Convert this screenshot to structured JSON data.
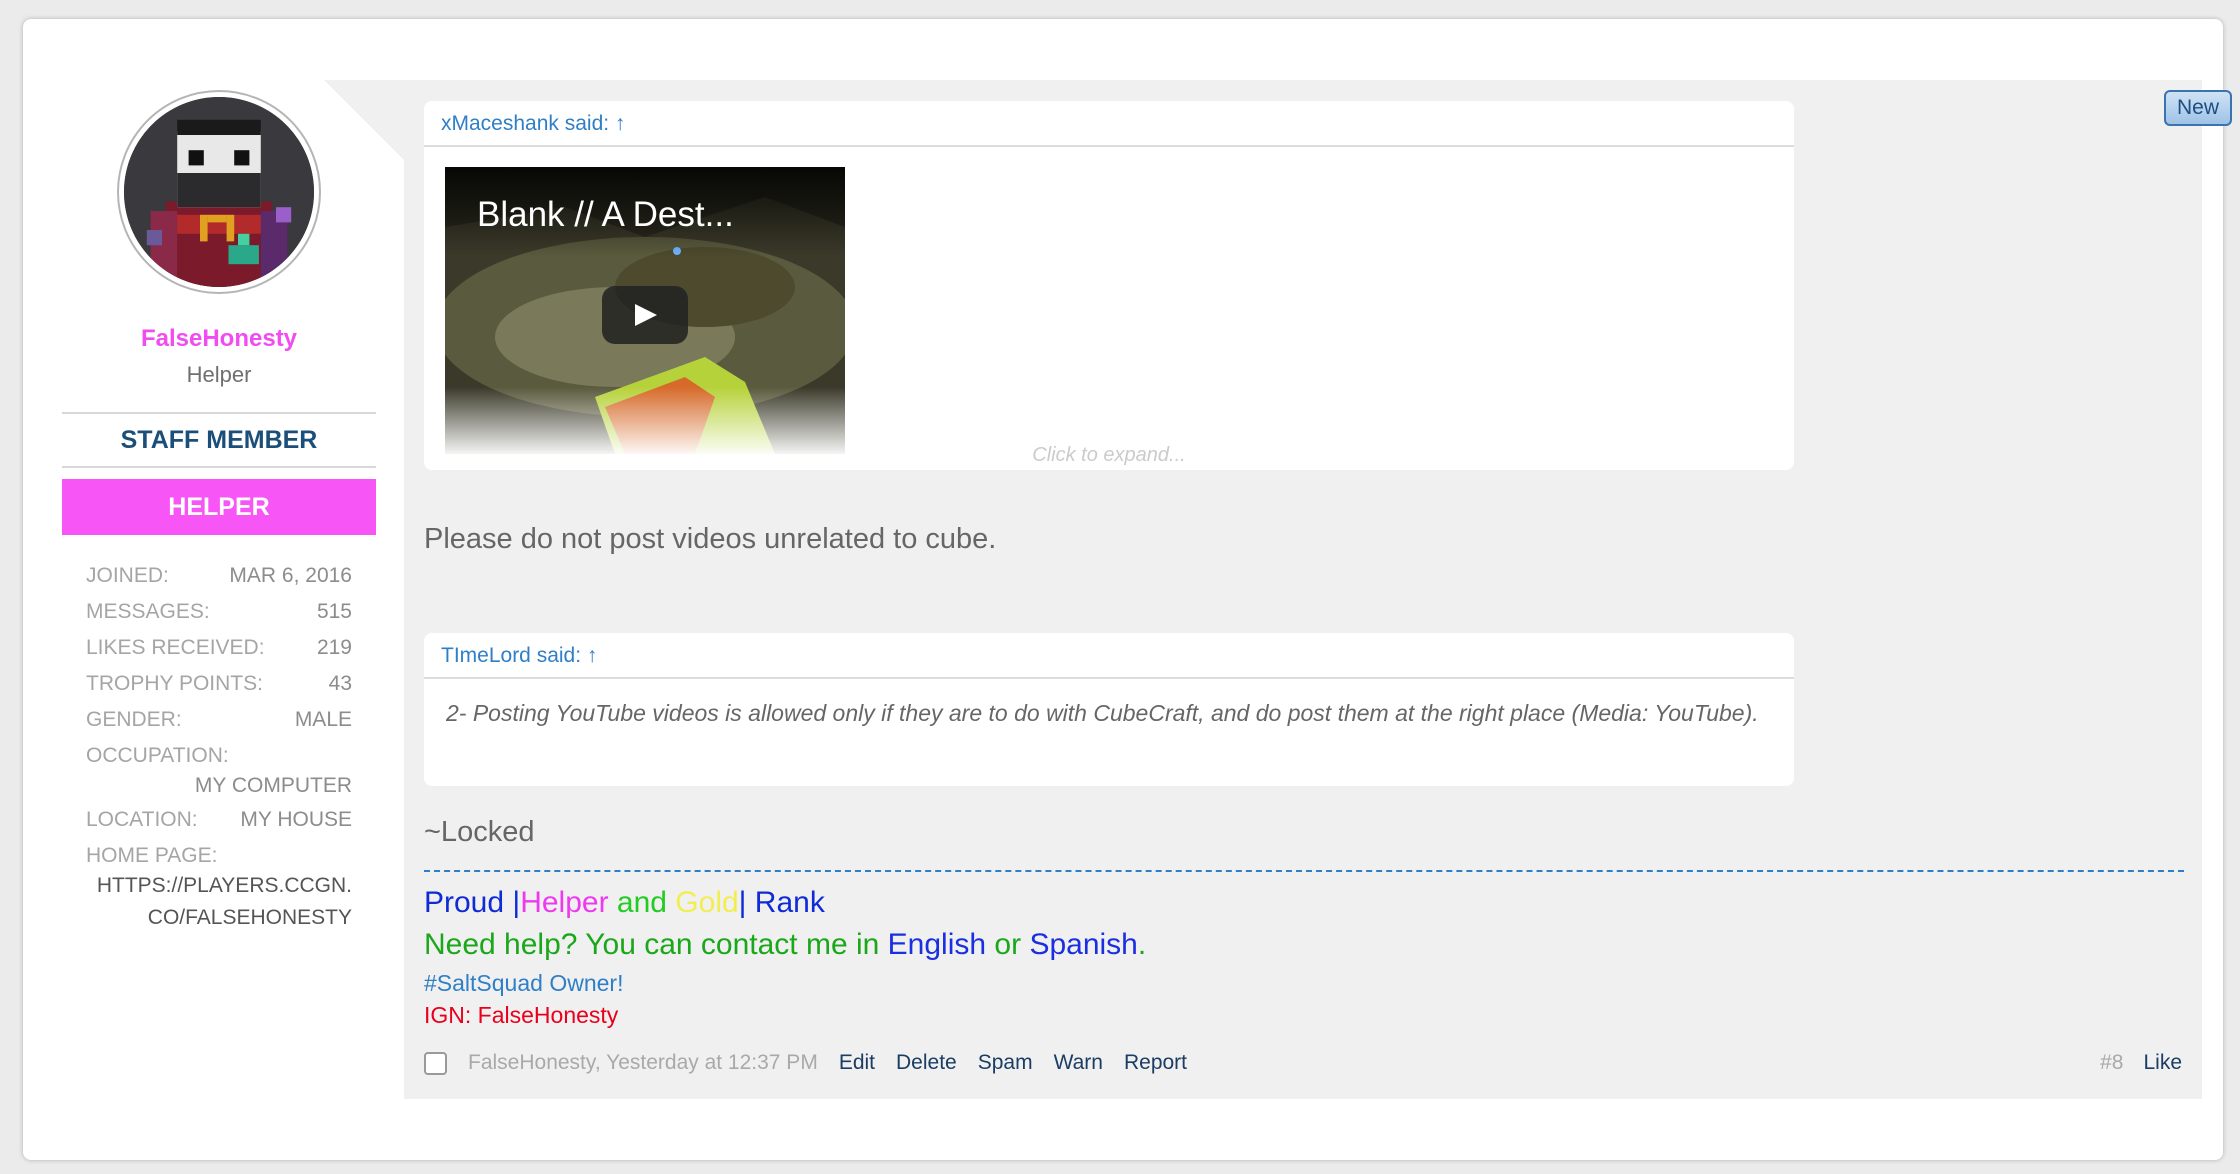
{
  "user": {
    "name": "FalseHonesty",
    "title": "Helper",
    "staff_banner": "STAFF MEMBER",
    "rank_banner": "HELPER",
    "stats": [
      {
        "label": "JOINED:",
        "value": "MAR 6, 2016"
      },
      {
        "label": "MESSAGES:",
        "value": "515"
      },
      {
        "label": "LIKES RECEIVED:",
        "value": "219"
      },
      {
        "label": "TROPHY POINTS:",
        "value": "43"
      },
      {
        "label": "GENDER:",
        "value": "MALE"
      }
    ],
    "occupation": {
      "label": "OCCUPATION:",
      "value": "MY COMPUTER"
    },
    "location": {
      "label": "LOCATION:",
      "value": "MY HOUSE"
    },
    "homepage": {
      "label": "HOME PAGE:",
      "line1": "HTTPS://PLAYERS.CCGN.",
      "line2": "CO/FALSEHONESTY"
    }
  },
  "quote1": {
    "attribution": "xMaceshank said: ↑",
    "video_title": "Blank // A Dest...",
    "expand": "Click to expand..."
  },
  "reply_text": "Please do not post videos unrelated to cube.",
  "quote2": {
    "attribution": "TImeLord said: ↑",
    "text": "2- Posting YouTube videos is allowed only if they are to do with CubeCraft, and do post them at the right place (Media: YouTube)."
  },
  "locked_text": "~Locked",
  "signature": {
    "line1": [
      {
        "text": "Proud ",
        "color": "#0f2bd6"
      },
      {
        "text": "|",
        "color": "#0f2bd6"
      },
      {
        "text": "Helper",
        "color": "#ee3aee"
      },
      {
        "text": " and ",
        "color": "#22cc22"
      },
      {
        "text": "Gold",
        "color": "#f2ee52"
      },
      {
        "text": "|",
        "color": "#0f2bd6"
      },
      {
        "text": " Rank",
        "color": "#0f2bd6"
      }
    ],
    "line2": [
      {
        "text": "Need help? You can contact me in ",
        "color": "#1aa81a"
      },
      {
        "text": "English",
        "color": "#1a2fe0"
      },
      {
        "text": " or ",
        "color": "#1aa81a"
      },
      {
        "text": "Spanish",
        "color": "#1a2fe0"
      },
      {
        "text": ".",
        "color": "#1aa81a"
      }
    ],
    "line3": "#SaltSquad Owner!",
    "line4": "IGN: FalseHonesty"
  },
  "meta": {
    "author_date": "FalseHonesty, Yesterday at 12:37 PM",
    "controls": {
      "edit": "Edit",
      "delete": "Delete",
      "spam": "Spam",
      "warn": "Warn",
      "report": "Report"
    },
    "post_number": "#8",
    "like": "Like"
  },
  "new_badge": "New",
  "colors": {
    "username": "#f14cf1",
    "rank_banner": "#f755f6",
    "link": "#2f7fc7",
    "staff": "#1b4f7a"
  }
}
